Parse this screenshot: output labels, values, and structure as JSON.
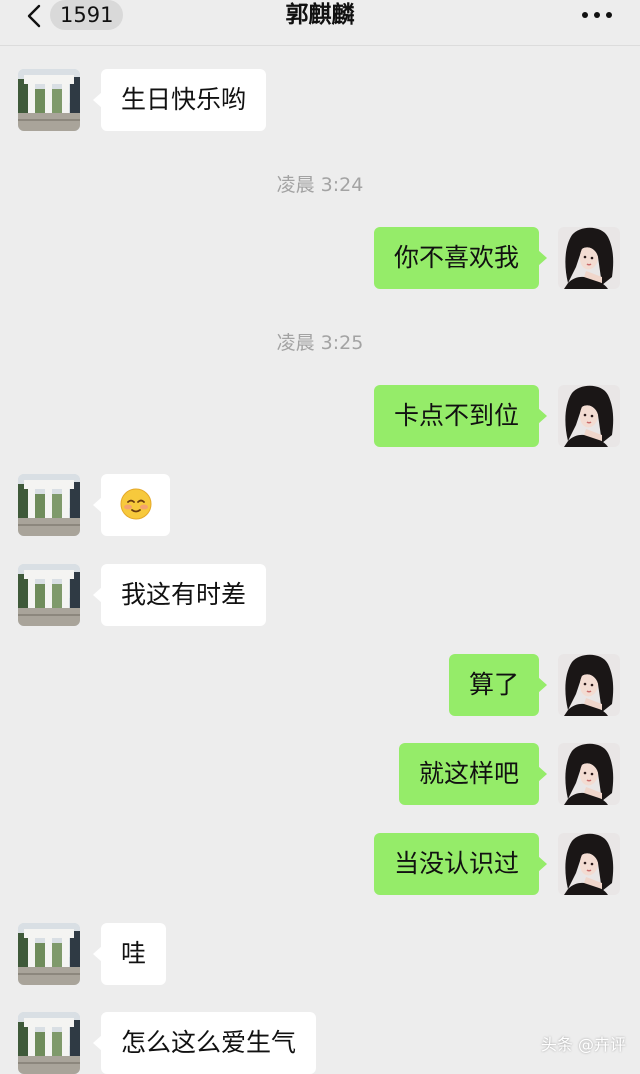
{
  "header": {
    "unread_count": "1591",
    "contact_name": "郭麒麟"
  },
  "messages": [
    {
      "side": "left",
      "text": "生日快乐哟"
    },
    {
      "time": "凌晨 3:24"
    },
    {
      "side": "right",
      "text": "你不喜欢我"
    },
    {
      "time": "凌晨 3:25"
    },
    {
      "side": "right",
      "text": "卡点不到位"
    },
    {
      "side": "left",
      "emoji": "smiling-blush-emoji"
    },
    {
      "side": "left",
      "text": "我这有时差"
    },
    {
      "side": "right",
      "text": "算了"
    },
    {
      "side": "right",
      "text": "就这样吧"
    },
    {
      "side": "right",
      "text": "当没认识过"
    },
    {
      "side": "left",
      "text": "哇"
    },
    {
      "side": "left",
      "text": "怎么这么爱生气"
    }
  ],
  "watermark": "头条 @卉评",
  "colors": {
    "background": "#ededed",
    "bubble_self": "#95ec69",
    "bubble_other": "#ffffff",
    "timestamp": "#a3a3a3"
  }
}
